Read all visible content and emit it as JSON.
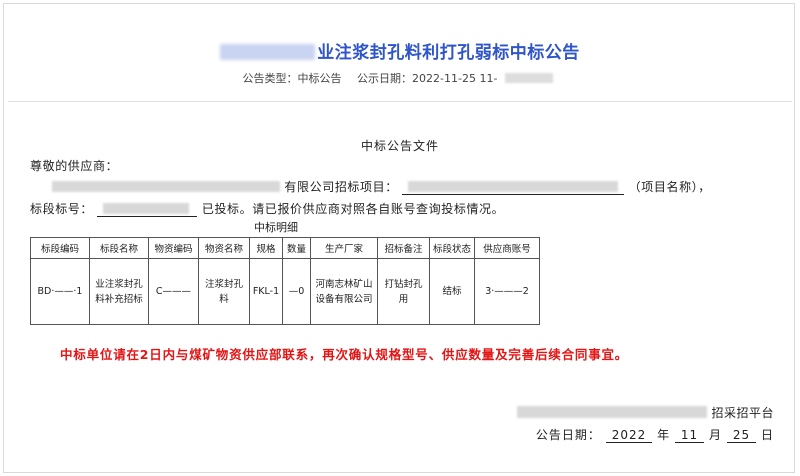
{
  "header": {
    "title_tail": "业注浆封孔料利打孔弱标中标公告",
    "meta_type_label": "公告类型：中标公告",
    "meta_time_label": "公示日期：2022-11-25  11-"
  },
  "document": {
    "doc_title": "中标公告文件",
    "greeting": "尊敬的供应商：",
    "line2_company_tail": "有限公司招标项目：",
    "line2_project_blur": "浆注浆封孔料孔招招标",
    "line2_project_suffix": "（项目名称），",
    "line3_prefix": "标段标号：",
    "line3_suffix": "已投标。请已报价供应商对照各自账号查询投标情况。"
  },
  "detail": {
    "caption": "中标明细",
    "headers": [
      "标段编码",
      "标段名称",
      "物资编码",
      "物资名称",
      "规格",
      "数量",
      "生产厂家",
      "招标备注",
      "标段状态",
      "供应商账号"
    ],
    "row": {
      "code": "BD·——·1",
      "name": "业注浆封孔料补充招标",
      "material_code": "C———",
      "material_name": "注浆封孔料",
      "spec": "FKL-1",
      "qty": "—0",
      "manufacturer": "河南志林矿山设备有限公司",
      "remark": "打钻封孔用",
      "status": "结标",
      "account": "3·———2"
    }
  },
  "notice": "中标单位请在2日内与煤矿物资供应部联系，再次确认规格型号、供应数量及完善后续合同事宜。",
  "footer": {
    "org_tail": "招采招平台",
    "date_label": "公告日期：",
    "year": "2022",
    "year_unit": "年",
    "month": "11",
    "month_unit": "月",
    "day": "25",
    "day_unit": "日"
  }
}
